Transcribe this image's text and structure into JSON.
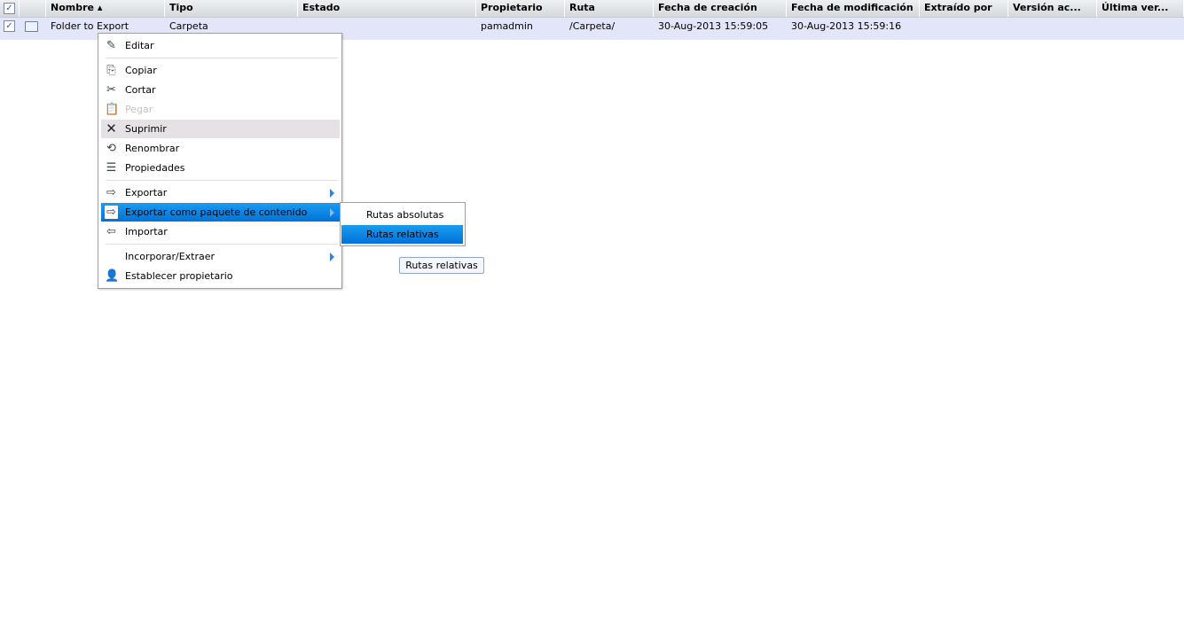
{
  "table": {
    "columns": [
      "Nombre ▴",
      "Tipo",
      "Estado",
      "Propietario",
      "Ruta",
      "Fecha de creación",
      "Fecha de modificación",
      "Extraído por",
      "Versión ac...",
      "Última ver..."
    ],
    "row": {
      "nombre": "Folder to Export",
      "tipo": "Carpeta",
      "estado": "",
      "propietario": "pamadmin",
      "ruta": "/Carpeta/",
      "creacion": "30-Aug-2013 15:59:05",
      "modificacion": "30-Aug-2013 15:59:16"
    }
  },
  "menu": {
    "items": [
      "Editar",
      "Copiar",
      "Cortar",
      "Pegar",
      "Suprimir",
      "Renombrar",
      "Propiedades",
      "Exportar",
      "Exportar como paquete de contenido",
      "Importar",
      "Incorporar/Extraer",
      "Establecer propietario"
    ]
  },
  "submenu": {
    "items": [
      "Rutas absolutas",
      "Rutas relativas"
    ]
  },
  "tooltip": "Rutas relativas",
  "colors": {
    "highlight": "#0a86e6",
    "row": "#e3e6f9"
  }
}
